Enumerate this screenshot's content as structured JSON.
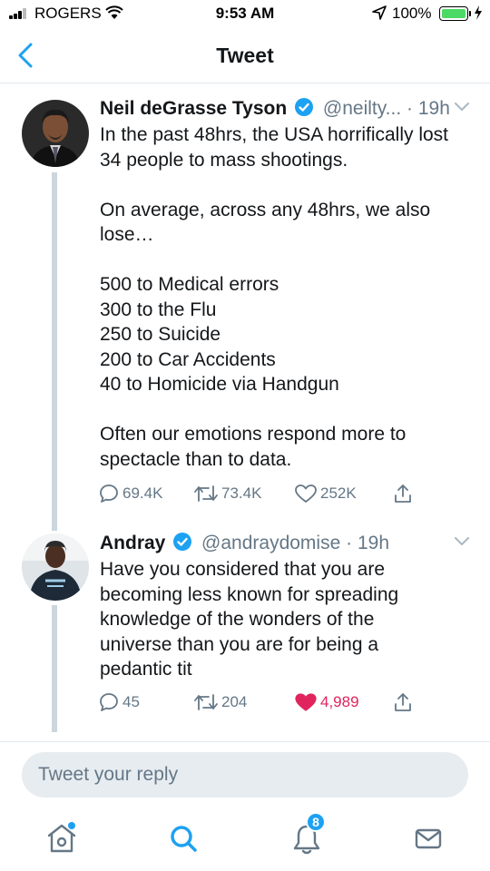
{
  "status_bar": {
    "carrier": "ROGERS",
    "time": "9:53 AM",
    "battery": "100%"
  },
  "header": {
    "title": "Tweet"
  },
  "tweets": [
    {
      "display_name": "Neil deGrasse Tyson",
      "handle": "@neilty...",
      "separator": "·",
      "time": "19h",
      "lines": [
        "In the past 48hrs, the USA horrifically lost 34 people to mass shootings.",
        "",
        "On average, across any 48hrs, we also lose…",
        "",
        "500 to Medical errors",
        "300 to the Flu",
        "250 to Suicide",
        "200 to Car Accidents",
        "40 to Homicide via Handgun",
        "",
        "Often our emotions respond more to spectacle than to data."
      ],
      "replies": "69.4K",
      "retweets": "73.4K",
      "likes": "252K",
      "liked": false
    },
    {
      "display_name": "Andray",
      "handle": "@andraydomise",
      "separator": "·",
      "time": "19h",
      "lines": [
        "Have you considered that you are becoming less known for spreading knowledge of the wonders of the universe than you are for being a pedantic tit"
      ],
      "replies": "45",
      "retweets": "204",
      "likes": "4,989",
      "liked": true
    }
  ],
  "reply": {
    "placeholder": "Tweet your reply"
  },
  "tab_bar": {
    "notifications_badge": "8",
    "items": [
      "home-icon",
      "search-icon",
      "notifications-icon",
      "messages-icon"
    ]
  },
  "colors": {
    "accent": "#1da1f2",
    "like": "#e0245e",
    "muted": "#657786",
    "thread_line": "#ccd6dd"
  }
}
